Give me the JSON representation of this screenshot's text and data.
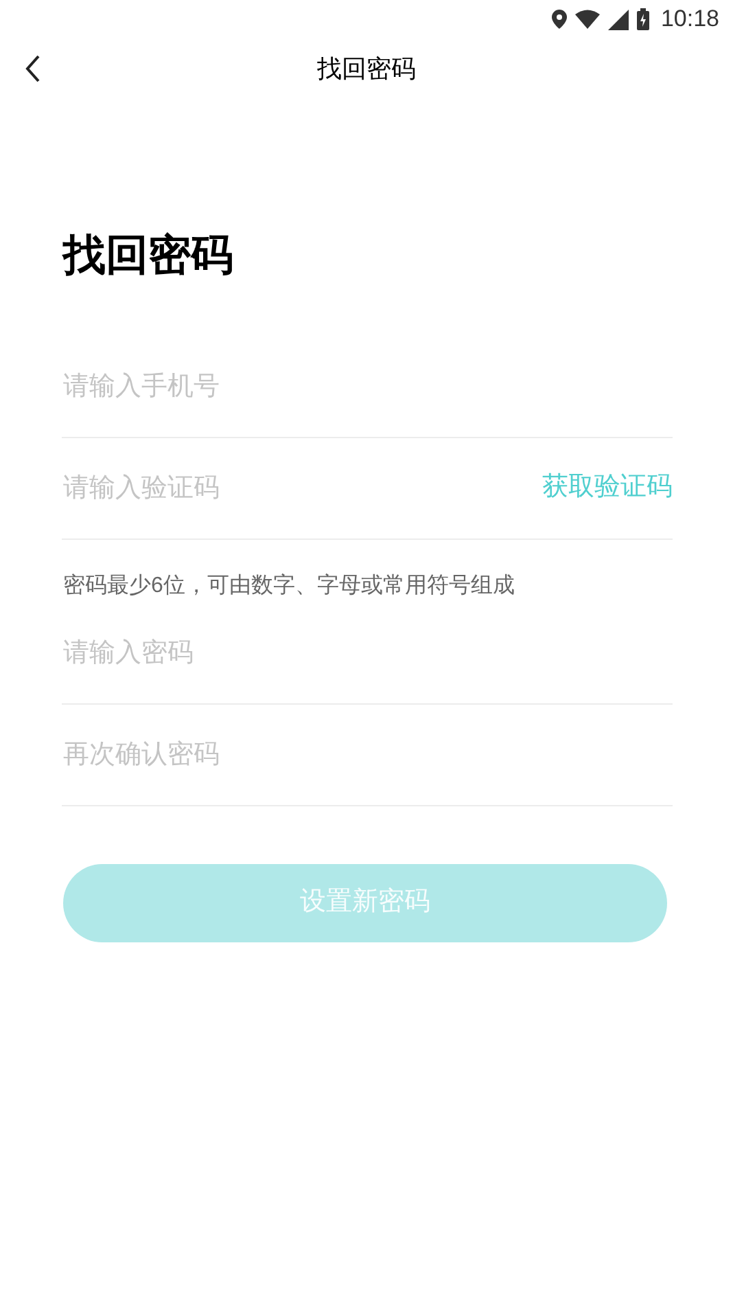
{
  "status_bar": {
    "time": "10:18"
  },
  "header": {
    "title": "找回密码"
  },
  "heading": "找回密码",
  "fields": [
    {
      "placeholder": "请输入手机号"
    },
    {
      "placeholder": "请输入验证码",
      "action": "获取验证码"
    },
    {
      "note": "密码最少6位，可由数字、字母或常用符号组成",
      "placeholder": "请输入密码"
    },
    {
      "placeholder": "再次确认密码"
    }
  ],
  "submit": {
    "label": "设置新密码",
    "disabled": true
  }
}
